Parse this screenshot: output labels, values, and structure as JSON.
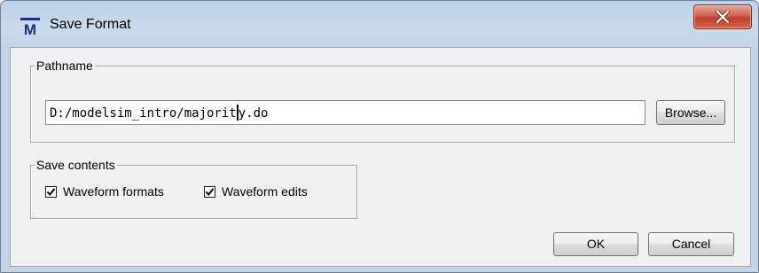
{
  "window": {
    "title": "Save Format",
    "app_icon_letter": "M"
  },
  "pathname": {
    "label": "Pathname",
    "value_before_caret": "D:/modelsim_intro/majorit",
    "value_after_caret": "y.do",
    "browse_label": "Browse..."
  },
  "save_contents": {
    "label": "Save contents",
    "waveform_formats": {
      "label": "Waveform formats",
      "checked": true
    },
    "waveform_edits": {
      "label": "Waveform edits",
      "checked": true
    }
  },
  "buttons": {
    "ok": "OK",
    "cancel": "Cancel"
  },
  "colors": {
    "frame": "#c3d4e7",
    "client": "#f0f0f0",
    "close_button": "#c74a33",
    "app_icon": "#1c2f7a"
  },
  "icons": {
    "app": "modelsim-icon",
    "close": "close-icon",
    "check": "check-icon"
  }
}
